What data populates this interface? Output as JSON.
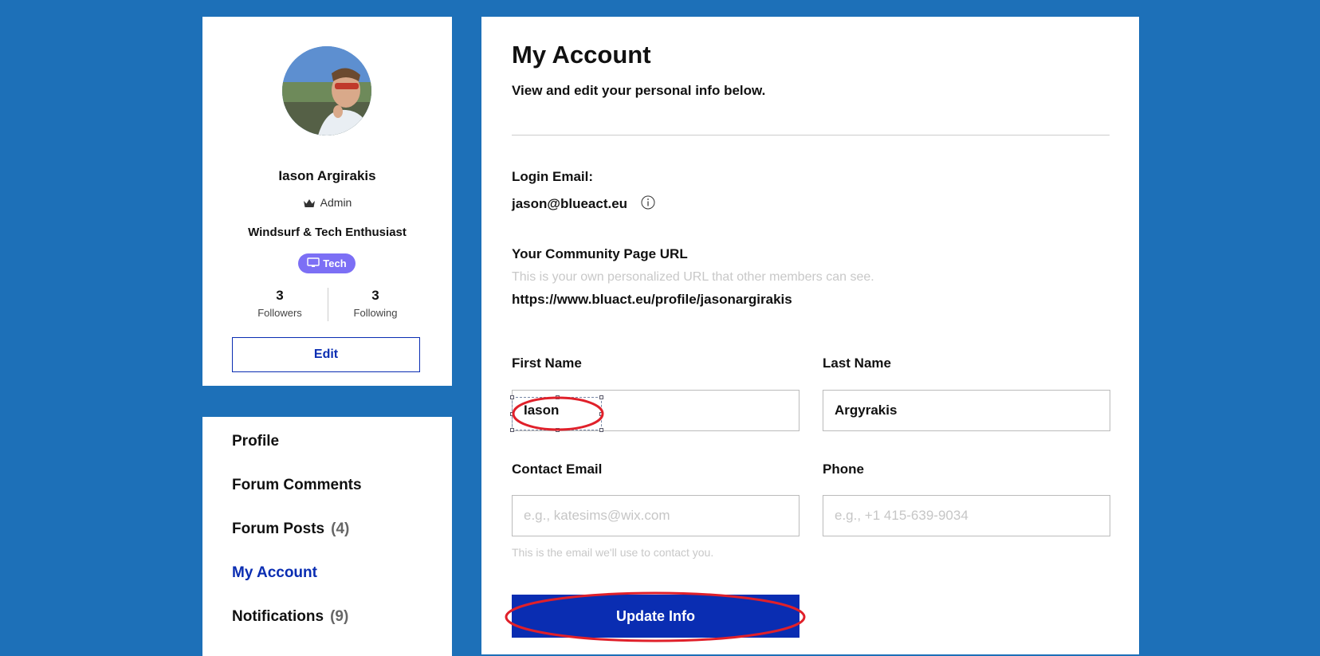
{
  "profile": {
    "name": "Iason Argirakis",
    "role": "Admin",
    "bio": "Windsurf & Tech Enthusiast",
    "badge": "Tech",
    "followers_count": "3",
    "followers_label": "Followers",
    "following_count": "3",
    "following_label": "Following",
    "edit_label": "Edit"
  },
  "nav": {
    "items": [
      {
        "label": "Profile",
        "count": ""
      },
      {
        "label": "Forum Comments",
        "count": ""
      },
      {
        "label": "Forum Posts",
        "count": "(4)"
      },
      {
        "label": "My Account",
        "count": ""
      },
      {
        "label": "Notifications",
        "count": "(9)"
      }
    ],
    "active": "My Account"
  },
  "account": {
    "title": "My Account",
    "subtitle": "View and edit your personal info below.",
    "login_email_label": "Login Email:",
    "login_email": "jason@blueact.eu",
    "community_url_label": "Your Community Page URL",
    "community_url_hint": "This is your own personalized URL that other members can see.",
    "community_url": "https://www.bluact.eu/profile/jasonargirakis",
    "first_name_label": "First Name",
    "first_name_value": "Iason",
    "last_name_label": "Last Name",
    "last_name_value": "Argyrakis",
    "contact_email_label": "Contact Email",
    "contact_email_placeholder": "e.g., katesims@wix.com",
    "contact_email_hint": "This is the email we'll use to contact you.",
    "phone_label": "Phone",
    "phone_placeholder": "e.g., +1 415-639-9034",
    "update_label": "Update Info"
  },
  "colors": {
    "background": "#1d70b8",
    "accent": "#0a2db2",
    "badge": "#7c6ff5",
    "annotation": "#e0202a"
  }
}
